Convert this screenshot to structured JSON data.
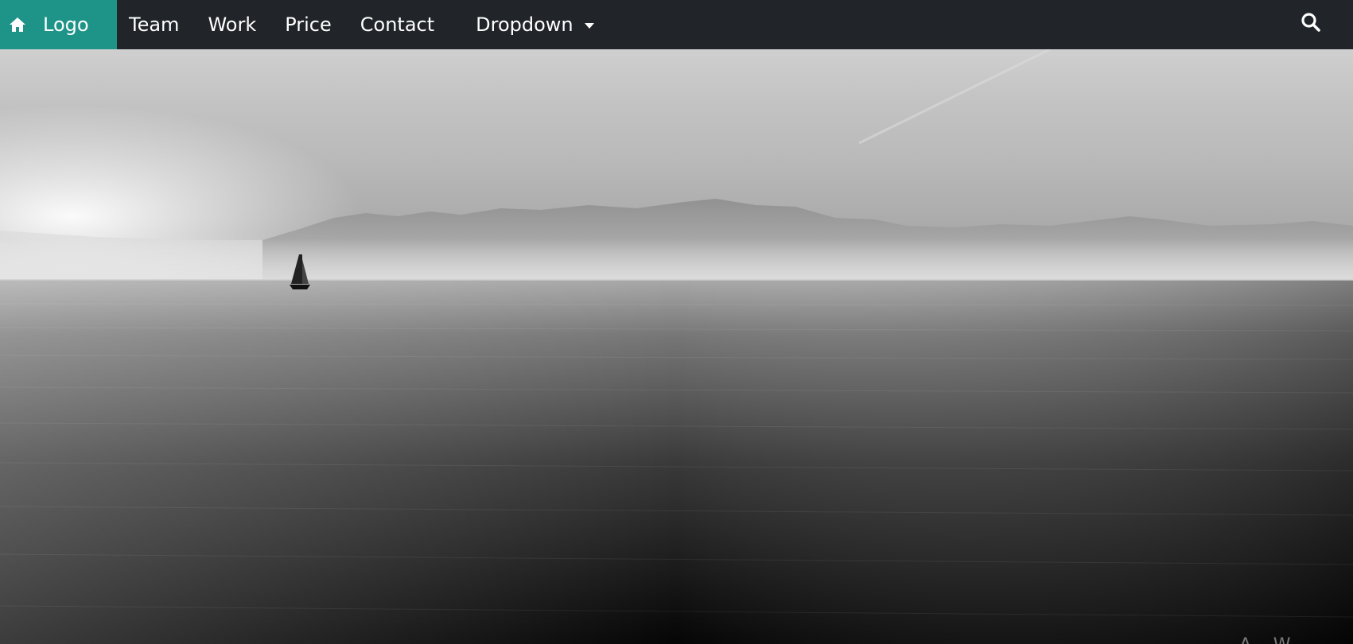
{
  "nav": {
    "brand_label": "Logo",
    "brand_icon": "home-icon",
    "links": [
      {
        "label": "Team"
      },
      {
        "label": "Work"
      },
      {
        "label": "Price"
      },
      {
        "label": "Contact"
      }
    ],
    "dropdown_label": "Dropdown",
    "search_icon": "search-icon"
  },
  "hero": {
    "image": "grayscale seascape with sailboat and distant mountains",
    "caption": "A... W... "
  },
  "colors": {
    "navbar_bg": "#212529",
    "brand_bg": "#1e9488",
    "nav_text": "#ffffff"
  }
}
